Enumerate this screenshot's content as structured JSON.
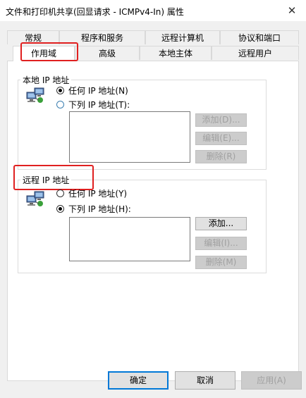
{
  "window": {
    "title": "文件和打印机共享(回显请求 - ICMPv4-In) 属性",
    "close_glyph": "✕"
  },
  "tabs": {
    "row1": [
      "常规",
      "程序和服务",
      "远程计算机",
      "协议和端口"
    ],
    "row2": [
      "作用域",
      "高级",
      "本地主体",
      "远程用户"
    ],
    "active": "作用域"
  },
  "local_ip": {
    "group_label": "本地 IP 地址",
    "option_any": "任何 IP 地址(N)",
    "option_list": "下列 IP 地址(T):",
    "selected": "any",
    "add_button": "添加(D)...",
    "edit_button": "编辑(E)...",
    "remove_button": "删除(R)"
  },
  "remote_ip": {
    "group_label": "远程 IP 地址",
    "option_any": "任何 IP 地址(Y)",
    "option_list": "下列 IP 地址(H):",
    "selected": "list",
    "add_button": "添加...",
    "edit_button": "编辑(I)...",
    "remove_button": "删除(M)"
  },
  "dialog_buttons": {
    "ok": "确定",
    "cancel": "取消",
    "apply": "应用(A)"
  },
  "colors": {
    "annotation": "#e02020",
    "default_button_border": "#0078d7"
  },
  "icons": [
    "close-icon",
    "network-computers-icon"
  ]
}
